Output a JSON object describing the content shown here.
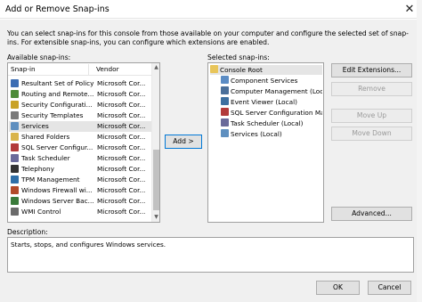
{
  "window": {
    "title": "Add or Remove Snap-ins",
    "close_glyph": "✕"
  },
  "intro": "You can select snap-ins for this console from those available on your computer and configure the selected set of snap-ins. For extensible snap-ins, you can configure which extensions are enabled.",
  "available": {
    "label": "Available snap-ins:",
    "columns": [
      "Snap-in",
      "Vendor"
    ],
    "rows": [
      {
        "name": "Resultant Set of Policy",
        "vendor": "Microsoft Cor...",
        "icon": "policy-icon",
        "color": "#3b6db3"
      },
      {
        "name": "Routing and Remote...",
        "vendor": "Microsoft Cor...",
        "icon": "routing-icon",
        "color": "#4e8c3a"
      },
      {
        "name": "Security Configurati...",
        "vendor": "Microsoft Cor...",
        "icon": "security-config-icon",
        "color": "#c9a227"
      },
      {
        "name": "Security Templates",
        "vendor": "Microsoft Cor...",
        "icon": "security-template-icon",
        "color": "#7a7a7a"
      },
      {
        "name": "Services",
        "vendor": "Microsoft Cor...",
        "icon": "services-gear-icon",
        "color": "#5f8fbf",
        "selected": true
      },
      {
        "name": "Shared Folders",
        "vendor": "Microsoft Cor...",
        "icon": "shared-folder-icon",
        "color": "#d9b44a"
      },
      {
        "name": "SQL Server Configur...",
        "vendor": "Microsoft Cor...",
        "icon": "sql-icon",
        "color": "#b23a3a"
      },
      {
        "name": "Task Scheduler",
        "vendor": "Microsoft Cor...",
        "icon": "scheduler-icon",
        "color": "#6a6a9a"
      },
      {
        "name": "Telephony",
        "vendor": "Microsoft Cor...",
        "icon": "telephony-icon",
        "color": "#333333"
      },
      {
        "name": "TPM Management",
        "vendor": "Microsoft Cor...",
        "icon": "tpm-icon",
        "color": "#2f6fa8"
      },
      {
        "name": "Windows Firewall wi...",
        "vendor": "Microsoft Cor...",
        "icon": "firewall-icon",
        "color": "#b24a2a"
      },
      {
        "name": "Windows Server Bac...",
        "vendor": "Microsoft Cor...",
        "icon": "backup-icon",
        "color": "#3a7a3a"
      },
      {
        "name": "WMI Control",
        "vendor": "Microsoft Cor...",
        "icon": "wmi-icon",
        "color": "#6b6b6b"
      }
    ]
  },
  "add_button": "Add >",
  "selected": {
    "label": "Selected snap-ins:",
    "root": "Console Root",
    "items": [
      {
        "name": "Component Services",
        "icon": "component-services-icon",
        "color": "#5b8cc4"
      },
      {
        "name": "Computer Management (Local)",
        "icon": "computer-management-icon",
        "color": "#4a6f9a"
      },
      {
        "name": "Event Viewer (Local)",
        "icon": "event-viewer-icon",
        "color": "#3c6fa0"
      },
      {
        "name": "SQL Server Configuration Mana",
        "icon": "sql-icon",
        "color": "#b23a3a"
      },
      {
        "name": "Task Scheduler (Local)",
        "icon": "scheduler-icon",
        "color": "#6a6a9a"
      },
      {
        "name": "Services (Local)",
        "icon": "services-gear-icon",
        "color": "#5f8fbf"
      }
    ]
  },
  "buttons": {
    "edit_extensions": "Edit Extensions...",
    "remove": "Remove",
    "move_up": "Move Up",
    "move_down": "Move Down",
    "advanced": "Advanced...",
    "ok": "OK",
    "cancel": "Cancel"
  },
  "description": {
    "label": "Description:",
    "text": "Starts, stops, and configures Windows services."
  }
}
